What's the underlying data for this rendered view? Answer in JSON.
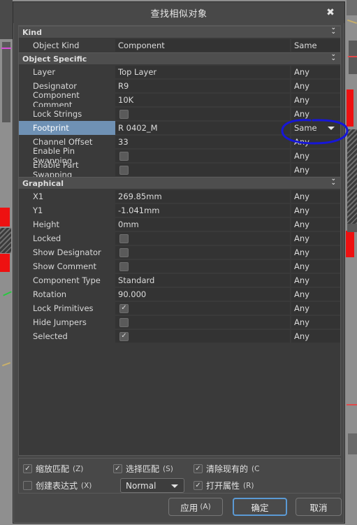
{
  "window": {
    "title": "查找相似对象",
    "close_icon": "close-icon"
  },
  "grid": {
    "sections": [
      {
        "name": "Kind",
        "collapse_icon": "chevron-double-down-icon",
        "rows": [
          {
            "label": "Object Kind",
            "value": "Component",
            "type": "text",
            "mode": "Same",
            "mode_dropdown": false
          }
        ]
      },
      {
        "name": "Object Specific",
        "collapse_icon": "chevron-double-down-icon",
        "rows": [
          {
            "label": "Layer",
            "value": "Top Layer",
            "type": "text",
            "mode": "Any",
            "mode_dropdown": false
          },
          {
            "label": "Designator",
            "value": "R9",
            "type": "text",
            "mode": "Any",
            "mode_dropdown": false
          },
          {
            "label": "Component Comment",
            "value": "10K",
            "type": "text",
            "mode": "Any",
            "mode_dropdown": false
          },
          {
            "label": "Lock Strings",
            "value": "",
            "type": "checkbox",
            "checked": false,
            "mode": "Any",
            "mode_dropdown": false
          },
          {
            "label": "Footprint",
            "value": "R 0402_M",
            "type": "text",
            "mode": "Same",
            "mode_dropdown": true,
            "selected": true
          },
          {
            "label": "Channel Offset",
            "value": "33",
            "type": "text",
            "mode": "Any",
            "mode_dropdown": false
          },
          {
            "label": "Enable Pin Swapping",
            "value": "",
            "type": "checkbox",
            "checked": false,
            "mode": "Any",
            "mode_dropdown": false
          },
          {
            "label": "Enable Part Swapping",
            "value": "",
            "type": "checkbox",
            "checked": false,
            "mode": "Any",
            "mode_dropdown": false
          }
        ]
      },
      {
        "name": "Graphical",
        "collapse_icon": "chevron-double-down-icon",
        "rows": [
          {
            "label": "X1",
            "value": "269.85mm",
            "type": "text",
            "mode": "Any",
            "mode_dropdown": false
          },
          {
            "label": "Y1",
            "value": "-1.041mm",
            "type": "text",
            "mode": "Any",
            "mode_dropdown": false
          },
          {
            "label": "Height",
            "value": "0mm",
            "type": "text",
            "mode": "Any",
            "mode_dropdown": false
          },
          {
            "label": "Locked",
            "value": "",
            "type": "checkbox",
            "checked": false,
            "mode": "Any",
            "mode_dropdown": false
          },
          {
            "label": "Show Designator",
            "value": "",
            "type": "checkbox",
            "checked": false,
            "mode": "Any",
            "mode_dropdown": false
          },
          {
            "label": "Show Comment",
            "value": "",
            "type": "checkbox",
            "checked": false,
            "mode": "Any",
            "mode_dropdown": false
          },
          {
            "label": "Component Type",
            "value": "Standard",
            "type": "text",
            "mode": "Any",
            "mode_dropdown": false
          },
          {
            "label": "Rotation",
            "value": "90.000",
            "type": "text",
            "mode": "Any",
            "mode_dropdown": false
          },
          {
            "label": "Lock Primitives",
            "value": "",
            "type": "checkbox",
            "checked": true,
            "mode": "Any",
            "mode_dropdown": false
          },
          {
            "label": "Hide Jumpers",
            "value": "",
            "type": "checkbox",
            "checked": false,
            "mode": "Any",
            "mode_dropdown": false
          },
          {
            "label": "Selected",
            "value": "",
            "type": "checkbox",
            "checked": true,
            "mode": "Any",
            "mode_dropdown": false
          }
        ]
      }
    ]
  },
  "options": {
    "zoom_match": {
      "label": "缩放匹配",
      "mnemonic": "(Z)",
      "checked": true
    },
    "select_match": {
      "label": "选择匹配",
      "mnemonic": "(S)",
      "checked": true
    },
    "clear_existing": {
      "label": "清除现有的",
      "mnemonic": "(C",
      "checked": true
    },
    "create_expression": {
      "label": "创建表达式",
      "mnemonic": "(X)",
      "checked": false
    },
    "open_properties": {
      "label": "打开属性",
      "mnemonic": "(R)",
      "checked": true
    },
    "mode_select": {
      "value": "Normal",
      "caret_icon": "chevron-down-icon"
    }
  },
  "buttons": {
    "apply": {
      "label": "应用",
      "mnemonic": "(A)"
    },
    "ok": {
      "label": "确定",
      "mnemonic": ""
    },
    "cancel": {
      "label": "取消",
      "mnemonic": ""
    }
  },
  "annotation": {
    "type": "hand-drawn-ellipse",
    "color": "#1616d8",
    "targets": "footprint-mode-cell"
  }
}
